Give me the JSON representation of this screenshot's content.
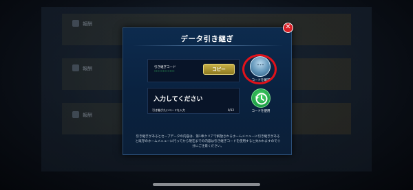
{
  "background": {
    "items": [
      "報酬",
      "報酬",
      "報酬"
    ]
  },
  "dialog": {
    "title": "データ引き継ぎ",
    "code_label": "引き継ぎコード",
    "code_value": "************",
    "copy_label": "コピー",
    "input_value": "入力してください",
    "input_hint": "引き継ぎたいコードを入力",
    "input_count": "0/12",
    "verify_dots": "***",
    "verify_label": "コードを確認",
    "use_label": "コードを使用",
    "notice": "引き継ぎがあるとセーブデータの内容は、第1章クリアで解放されるホームメニューに引き継ぎがあると既存のホームメニューに行ってから現在までの内容は引き継ぎコードを使用すると失われますので十分にご注意ください。"
  },
  "colors": {
    "close": "#d81f26",
    "highlight": "#e2121a",
    "copy_button": "#c7b046",
    "use_button": "#1fa047"
  },
  "icons": {
    "close": "close-icon",
    "verify": "code-confirm-icon",
    "use": "history-icon"
  }
}
